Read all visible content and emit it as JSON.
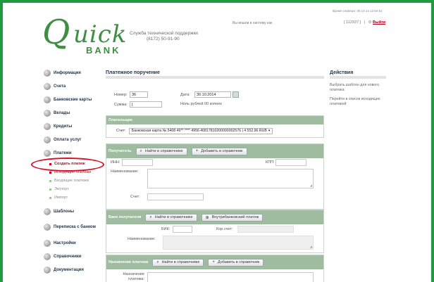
{
  "header": {
    "logo": {
      "q": "Q",
      "uick": "uick",
      "bank": "BANK"
    },
    "support_title": "Служба технической поддержки",
    "support_phone": "(8172) 50-91-90",
    "logged_in_label": "Вы вошли в систему как",
    "server_time": "Время сервера: 30.10.14 12:54:51",
    "user_id": "[ 112937 ]",
    "separator": "|",
    "logout_label": "Выйти"
  },
  "sidebar": {
    "items": [
      {
        "label": "Информация"
      },
      {
        "label": "Счета"
      },
      {
        "label": "Банковские карты"
      },
      {
        "label": "Вклады"
      },
      {
        "label": "Кредиты"
      },
      {
        "label": "Оплата услуг"
      },
      {
        "label": "Платежи"
      }
    ],
    "sub_items": [
      {
        "label": "Создать платеж"
      },
      {
        "label": "Исходящие платежи"
      },
      {
        "label": "Входящие платежи"
      },
      {
        "label": "Экспорт"
      },
      {
        "label": "Импорт"
      }
    ],
    "items_after": [
      {
        "label": "Шаблоны"
      },
      {
        "label": "Переписка с банком"
      },
      {
        "label": "Настройки"
      },
      {
        "label": "Справочники"
      },
      {
        "label": "Документация"
      }
    ]
  },
  "main": {
    "title": "Платежное поручение",
    "number_label": "Номер:",
    "number_value": "36",
    "date_label": "Дата:",
    "date_value": "30.10.2014",
    "sum_label": "Сумма:",
    "sum_value": "",
    "sum_words": "Ноль рублей 00 копеек",
    "payer": {
      "title": "Плательщик",
      "account_label": "Счет:",
      "account_value": "Банковская карта № 5408 49** **** 4956 40817810200000002576 | 4 552.96 RUB"
    },
    "recipient": {
      "title": "Получатель",
      "find_button": "Найти в справочнике",
      "add_button": "Добавить в справочник",
      "inn_label": "ИНН:",
      "kpp_label": "КПП:",
      "name_label": "Наименование:",
      "account_label": "Счет:"
    },
    "recipient_bank": {
      "title": "Банк получателя",
      "find_button": "Найти в справочнике",
      "internal_button": "Внутрибанковский платеж",
      "bik_label": "БИК:",
      "corr_label": "Кор.счет:",
      "name_label": "Наименование:"
    },
    "purpose": {
      "title": "Назначение платежа",
      "find_button": "Найти в справочнике",
      "add_button": "Добавить в справочник",
      "field_label_1": "Назначение",
      "field_label_2": "платежа:"
    }
  },
  "actions": {
    "title": "Действия",
    "links": [
      "Выбрать шаблон для нового платежа",
      "Перейти в список исходящих платежей"
    ]
  },
  "colors": {
    "border_green": "#1f9a3f",
    "section_header": "#9fbba0",
    "highlight_red": "#d8102a"
  }
}
